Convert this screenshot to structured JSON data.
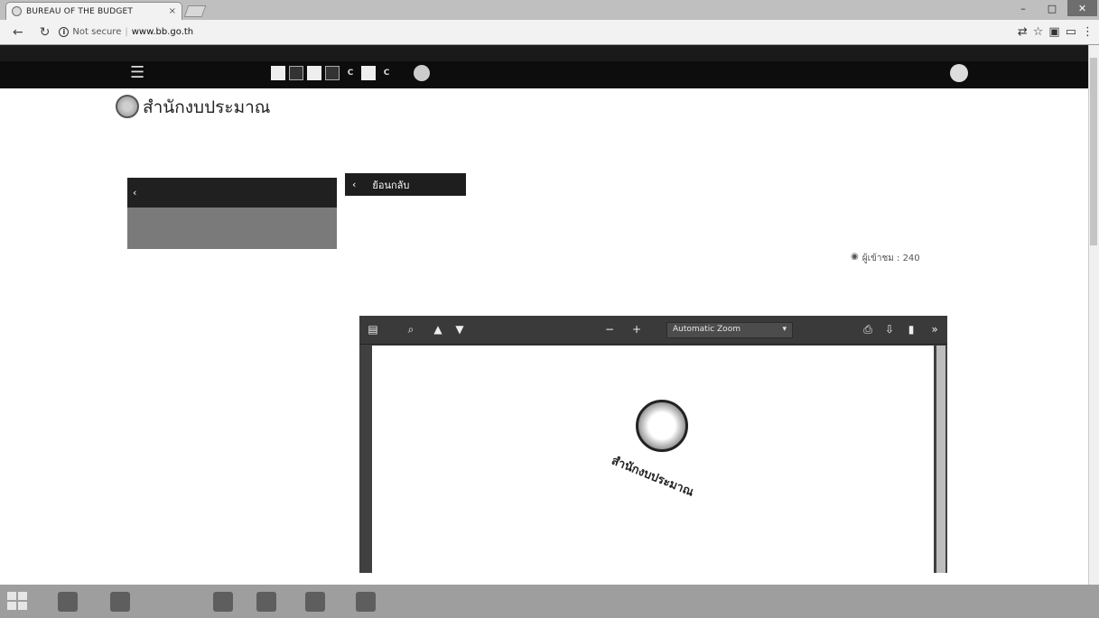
{
  "browser": {
    "tab_title": "BUREAU OF THE BUDGET",
    "tab_close": "×",
    "security_label": "Not secure",
    "url_domain": "www.bb.go.th",
    "url_path": "",
    "window_min": "–",
    "window_max": "□",
    "window_close": "✕"
  },
  "topbar": {
    "access_label": "",
    "font_buttons": [
      "",
      "",
      "",
      "",
      "C",
      "",
      "C"
    ],
    "search_label": "",
    "extra_label": "",
    "login_label": ""
  },
  "site": {
    "org_name": "สำนักงบประมาณ",
    "org_sub": "",
    "main_nav": [
      "",
      "",
      "",
      "",
      ""
    ],
    "sub_nav": [
      "",
      "",
      "",
      ""
    ]
  },
  "sidebar": {
    "header": "",
    "active_item": "",
    "items": [
      "",
      "",
      "",
      "",
      "",
      "",
      ""
    ]
  },
  "content": {
    "back_button": "ย้อนกลับ",
    "title": "",
    "views": "ผู้เข้าชม : 240"
  },
  "pdf_viewer": {
    "zoom": "Automatic Zoom",
    "seal_caption": "สำนักงบประมาณ"
  },
  "taskbar": {
    "clock": ""
  }
}
